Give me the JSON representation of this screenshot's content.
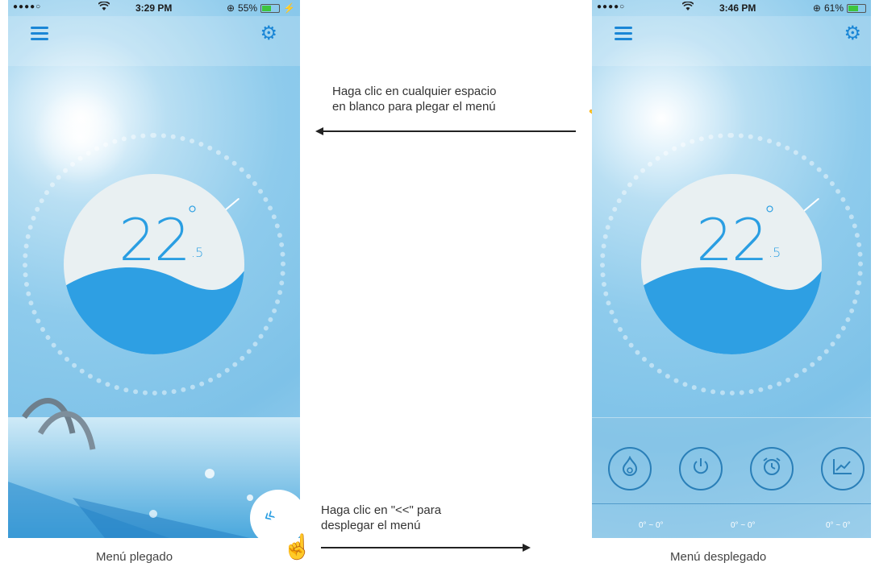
{
  "left_phone": {
    "status": {
      "signal": "●●●●○",
      "time": "3:29 PM",
      "battery": "55%",
      "battery_level": 0.55
    },
    "temperature": {
      "whole": "22",
      "degree": "°",
      "decimal": ".5"
    },
    "icons": {
      "menu": "hamburger-icon",
      "settings": "gear-icon",
      "expand": "double-chevron-icon"
    },
    "caption": "Menú plegado"
  },
  "right_phone": {
    "status": {
      "signal": "●●●●○",
      "time": "3:46 PM",
      "battery": "61%",
      "battery_level": 0.61
    },
    "temperature": {
      "whole": "22",
      "degree": "°",
      "decimal": ".5"
    },
    "menu_buttons": [
      {
        "icon": "heat-icon",
        "range": "0° ~ 0°"
      },
      {
        "icon": "power-icon",
        "range": "0° ~ 0°"
      },
      {
        "icon": "alarm-clock-icon",
        "range": "0° ~ 0°"
      },
      {
        "icon": "chart-icon",
        "range": ""
      }
    ],
    "ranges": [
      "0° ~ 0°",
      "0° ~ 0°",
      "0° ~ 0°"
    ],
    "caption": "Menú desplegado"
  },
  "annotations": {
    "collapse_line1": "Haga clic en cualquier espacio",
    "collapse_line2": "en blanco para plegar el menú",
    "expand_line1": "Haga clic en \"<<\" para",
    "expand_line2": "desplegar el menú"
  },
  "colors": {
    "accent": "#1a86d6",
    "temp_text": "#2a9ee2",
    "water": "#2e9fe3",
    "bowl": "#e9f0f2"
  }
}
